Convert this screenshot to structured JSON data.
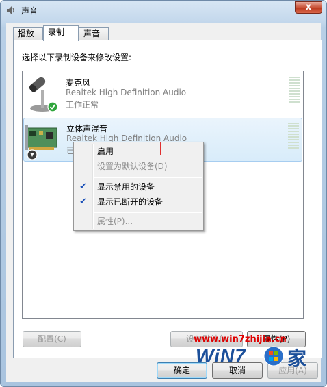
{
  "window": {
    "title": "声音",
    "close_label": "x"
  },
  "tabs": [
    {
      "label": "播放",
      "active": false
    },
    {
      "label": "录制",
      "active": true
    },
    {
      "label": "声音",
      "active": false
    }
  ],
  "panel": {
    "instruction": "选择以下录制设备来修改设置:"
  },
  "devices": [
    {
      "name": "麦克风",
      "description": "Realtek High Definition Audio",
      "status": "工作正常",
      "icon": "microphone-icon",
      "badge": "green-check-badge",
      "selected": false
    },
    {
      "name": "立体声混音",
      "description": "Realtek High Definition Audio",
      "status": "已",
      "icon": "sound-card-icon",
      "badge": "down-arrow-badge",
      "selected": true
    }
  ],
  "context_menu": {
    "items": [
      {
        "label": "启用",
        "disabled": false,
        "checked": false
      },
      {
        "label": "设置为默认设备(D)",
        "disabled": true,
        "checked": false
      },
      {
        "label": "显示禁用的设备",
        "disabled": false,
        "checked": true
      },
      {
        "label": "显示已断开的设备",
        "disabled": false,
        "checked": true
      },
      {
        "label": "属性(P)...",
        "disabled": true,
        "checked": false
      }
    ]
  },
  "panel_buttons": {
    "configure": "配置(C)",
    "set_default": "设为默认值",
    "properties": "属性(P)"
  },
  "dialog_buttons": {
    "ok": "确定",
    "cancel": "取消",
    "apply": "应用(A)"
  },
  "watermark": {
    "url": "www.win7zhijia.cn",
    "logo": "WiN7",
    "suffix": "家"
  },
  "colors": {
    "titlebar": "#c4d8ec",
    "selection": "#d8ecfa",
    "highlight_box": "#e03030",
    "watermark_url": "#e00000",
    "watermark_logo": "#1b4f9a"
  }
}
